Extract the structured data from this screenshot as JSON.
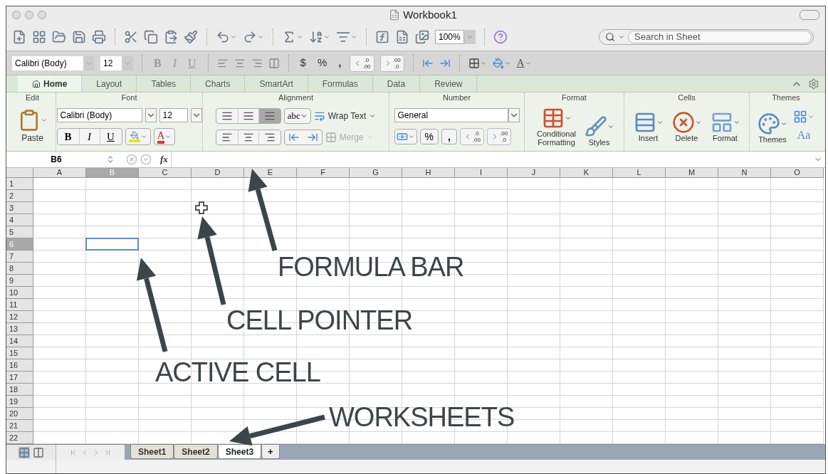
{
  "window": {
    "title": "Workbook1"
  },
  "toolbar": {
    "zoom": "100%",
    "search_placeholder": "Search in Sheet"
  },
  "format_bar": {
    "font": "Calibri (Body)",
    "size": "12",
    "bold": "B",
    "italic": "I",
    "underline": "U",
    "currency": "$",
    "percent": "%",
    "comma": ",",
    "dec_up": [
      ".0",
      ".00"
    ],
    "dec_down": [
      ".00",
      ".0"
    ],
    "color_letter": "A"
  },
  "ribbon_tabs": [
    {
      "label": "Home",
      "selected": true
    },
    {
      "label": "Layout",
      "selected": false
    },
    {
      "label": "Tables",
      "selected": false
    },
    {
      "label": "Charts",
      "selected": false
    },
    {
      "label": "SmartArt",
      "selected": false
    },
    {
      "label": "Formulas",
      "selected": false
    },
    {
      "label": "Data",
      "selected": false
    },
    {
      "label": "Review",
      "selected": false
    }
  ],
  "ribbon": {
    "edit": {
      "title": "Edit",
      "paste": "Paste"
    },
    "font": {
      "title": "Font",
      "font": "Calibri (Body)",
      "size": "12",
      "bold": "B",
      "italic": "I",
      "underline": "U",
      "color_letter": "A"
    },
    "alignment": {
      "title": "Alignment",
      "orientation": "abc",
      "wrap": "Wrap Text",
      "merge": "Merge",
      "merge_disabled": true
    },
    "number": {
      "title": "Number",
      "format": "General",
      "percent": "%",
      "comma": ",",
      "dec_up": [
        ".0",
        ".00"
      ],
      "dec_down": [
        ".00",
        ".0"
      ]
    },
    "format": {
      "title": "Format",
      "conditional": "Conditional Formatting",
      "styles": "Styles"
    },
    "cells": {
      "title": "Cells",
      "insert": "Insert",
      "delete": "Delete",
      "format": "Format"
    },
    "themes": {
      "title": "Themes",
      "themes": "Themes",
      "fonts": "Aa"
    }
  },
  "formula_bar": {
    "cell": "B6",
    "fx": "fx"
  },
  "grid": {
    "columns": [
      {
        "label": "A",
        "selected": false
      },
      {
        "label": "B",
        "selected": true
      },
      {
        "label": "C",
        "selected": false
      },
      {
        "label": "D",
        "selected": false
      },
      {
        "label": "E",
        "selected": false
      },
      {
        "label": "F",
        "selected": false
      },
      {
        "label": "G",
        "selected": false
      },
      {
        "label": "H",
        "selected": false
      },
      {
        "label": "I",
        "selected": false
      },
      {
        "label": "J",
        "selected": false
      },
      {
        "label": "K",
        "selected": false
      },
      {
        "label": "L",
        "selected": false
      },
      {
        "label": "M",
        "selected": false
      },
      {
        "label": "N",
        "selected": false
      },
      {
        "label": "O",
        "selected": false
      }
    ],
    "rows": [
      {
        "label": "1",
        "selected": false
      },
      {
        "label": "2",
        "selected": false
      },
      {
        "label": "3",
        "selected": false
      },
      {
        "label": "4",
        "selected": false
      },
      {
        "label": "5",
        "selected": false
      },
      {
        "label": "6",
        "selected": true
      },
      {
        "label": "7",
        "selected": false
      },
      {
        "label": "8",
        "selected": false
      },
      {
        "label": "9",
        "selected": false
      },
      {
        "label": "10",
        "selected": false
      },
      {
        "label": "11",
        "selected": false
      },
      {
        "label": "12",
        "selected": false
      },
      {
        "label": "13",
        "selected": false
      },
      {
        "label": "14",
        "selected": false
      },
      {
        "label": "15",
        "selected": false
      },
      {
        "label": "16",
        "selected": false
      },
      {
        "label": "17",
        "selected": false
      },
      {
        "label": "18",
        "selected": false
      },
      {
        "label": "19",
        "selected": false
      },
      {
        "label": "20",
        "selected": false
      },
      {
        "label": "21",
        "selected": false
      },
      {
        "label": "22",
        "selected": false
      }
    ]
  },
  "sheet_tabs": [
    {
      "label": "Sheet1",
      "selected": false
    },
    {
      "label": "Sheet2",
      "selected": false
    },
    {
      "label": "Sheet3",
      "selected": true
    }
  ],
  "add_sheet": "+",
  "annotations": [
    {
      "text": "FORMULA BAR"
    },
    {
      "text": "CELL POINTER"
    },
    {
      "text": "ACTIVE CELL"
    },
    {
      "text": "WORKSHEETS"
    }
  ]
}
